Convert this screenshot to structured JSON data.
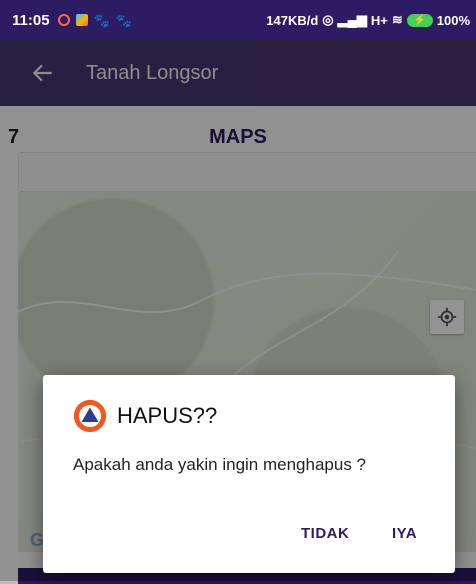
{
  "status_bar": {
    "time": "11:05",
    "network_speed": "147KB/d",
    "network_type": "H+",
    "battery_percent": "100%"
  },
  "app_bar": {
    "title": "Tanah Longsor"
  },
  "content": {
    "number_label": "7",
    "section_title": "MAPS",
    "map_logo_letter": "G"
  },
  "dialog": {
    "title": "HAPUS??",
    "message": "Apakah anda yakin ingin menghapus ?",
    "negative_button": "TIDAK",
    "positive_button": "IYA"
  },
  "colors": {
    "brand": "#2d1b63",
    "dialog_icon_outer": "#f05a22",
    "dialog_icon_inner": "#2a3f8f"
  }
}
